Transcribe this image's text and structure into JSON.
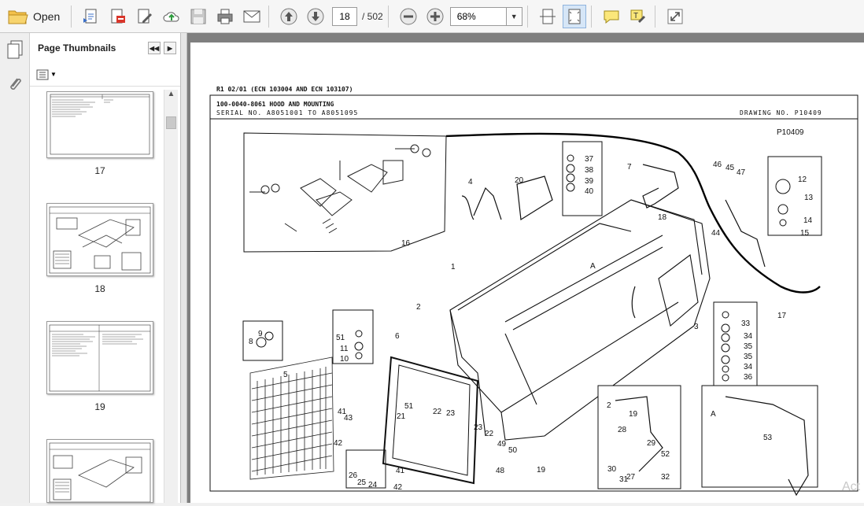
{
  "toolbar": {
    "open_label": "Open",
    "page_current": "18",
    "page_total": "/ 502",
    "zoom": "68%",
    "icons": [
      "open-folder-icon",
      "create-pdf-icon",
      "export-pdf-icon",
      "edit-pdf-icon",
      "cloud-upload-icon",
      "save-icon",
      "print-icon",
      "email-icon",
      "previous-page-icon",
      "next-page-icon",
      "zoom-out-icon",
      "zoom-in-icon",
      "fit-width-icon",
      "fit-page-icon",
      "comment-icon",
      "highlight-icon",
      "expand-icon"
    ]
  },
  "panel": {
    "title": "Page Thumbnails",
    "thumbnails": [
      {
        "label": "17"
      },
      {
        "label": "18"
      },
      {
        "label": "19"
      },
      {
        "label": ""
      }
    ]
  },
  "document": {
    "revision": "R1 02/01 (ECN 103004 AND ECN 103107)",
    "part_title": "100-0040-8061 HOOD AND MOUNTING",
    "serial": "SERIAL NO. A8051001 TO A8051095",
    "drawing_no": "DRAWING NO. P10409",
    "drawing_id": "P10409",
    "callouts": [
      "1",
      "2",
      "3",
      "4",
      "5",
      "6",
      "7",
      "8",
      "9",
      "10",
      "11",
      "12",
      "13",
      "14",
      "15",
      "16",
      "17",
      "18",
      "19",
      "20",
      "21",
      "22",
      "23",
      "24",
      "25",
      "26",
      "27",
      "28",
      "29",
      "30",
      "31",
      "32",
      "33",
      "34",
      "35",
      "36",
      "37",
      "38",
      "39",
      "40",
      "41",
      "42",
      "43",
      "44",
      "45",
      "46",
      "47",
      "48",
      "49",
      "50",
      "51",
      "52",
      "53",
      "A"
    ]
  },
  "watermark": "Act"
}
